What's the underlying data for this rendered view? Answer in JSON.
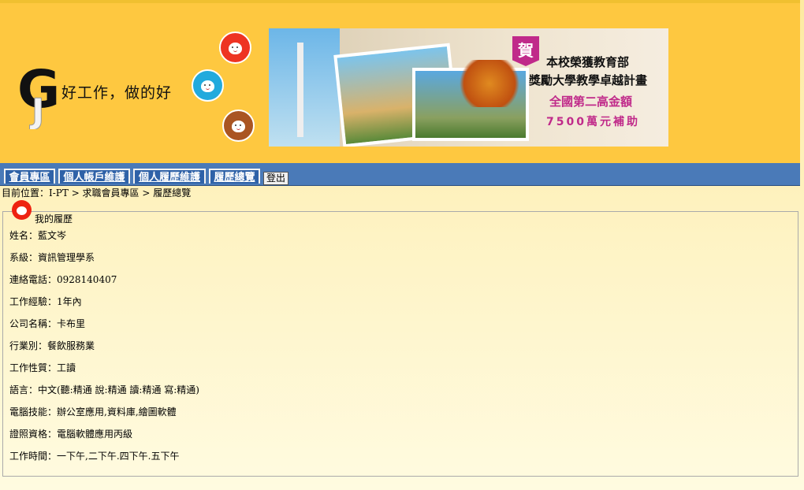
{
  "header": {
    "logo_text": "G",
    "logo_subtext": "J",
    "slogan": "好工作，做的好",
    "banner": {
      "badge": "賀",
      "line1": "本校榮獲教育部",
      "line2": "獎勵大學教學卓越計畫",
      "line3": "全國第二高金額",
      "line4": "7500萬元補助"
    }
  },
  "nav": {
    "member": "會員專區",
    "account": "個人帳戶維護",
    "resume_edit": "個人履歷維護",
    "resume_view": "履歷總覽",
    "logout": "登出"
  },
  "breadcrumb": "目前位置：I-PT > 求職會員專區 > 履歷總覽",
  "resume": {
    "title": "我的履歷",
    "fields": [
      "姓名：藍文岑",
      "系級：資訊管理學系",
      "連絡電話：0928140407",
      "工作經驗：1年內",
      "公司名稱：卡布里",
      "行業別：餐飲服務業",
      "工作性質：工讀",
      "語言：中文(聽:精通 說:精通 讀:精通 寫:精通)",
      "電腦技能：辦公室應用,資料庫,繪圖軟體",
      "證照資格：電腦軟體應用丙級",
      "工作時間：一下午,二下午.四下午.五下午"
    ]
  },
  "colors": {
    "header_bg": "#fec840",
    "nav_bg": "#4a7ab8",
    "nav_button": "#2f62a8"
  }
}
